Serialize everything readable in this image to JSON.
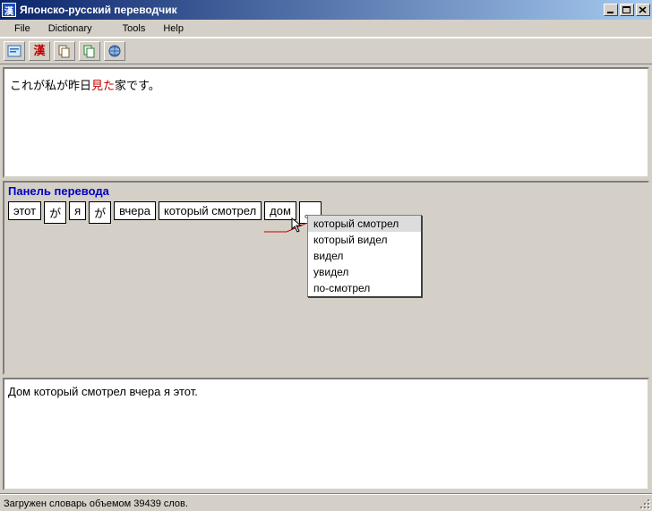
{
  "window": {
    "title": "Японско-русский переводчик"
  },
  "menu": {
    "file": "File",
    "dictionary": "Dictionary",
    "tools": "Tools",
    "help": "Help"
  },
  "toolbar_icons": {
    "first": "translate-icon",
    "second": "kanji-icon",
    "third": "copy-icon",
    "fourth": "paste-icon",
    "fifth": "globe-icon"
  },
  "source": {
    "pre": "これが私が昨日",
    "highlight": "見た",
    "post": "家です。"
  },
  "translation_panel": {
    "title": "Панель перевода",
    "tokens": [
      "этот",
      "が",
      "я",
      "が",
      "вчера",
      "который смотрел",
      "дом",
      "。"
    ],
    "dropdown": [
      "который смотрел",
      "который видел",
      "видел",
      "увидел",
      "по-смотрел"
    ],
    "selected_index": 0
  },
  "output": {
    "text": "Дом который смотрел вчера я этот."
  },
  "status": {
    "text": "Загружен словарь объемом 39439 слов."
  }
}
